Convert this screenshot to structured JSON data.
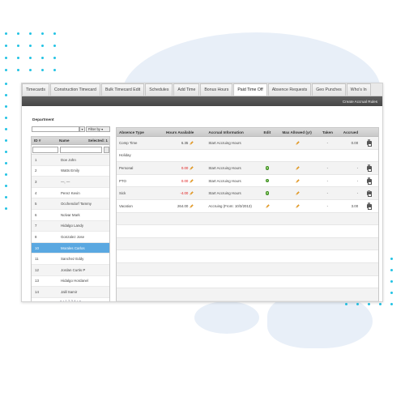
{
  "tabs": [
    {
      "label": "Timecards",
      "active": false
    },
    {
      "label": "Construction Timecard",
      "active": false
    },
    {
      "label": "Bulk Timecard Edit",
      "active": false
    },
    {
      "label": "Schedules",
      "active": false
    },
    {
      "label": "Add Time",
      "active": false
    },
    {
      "label": "Bonus Hours",
      "active": false
    },
    {
      "label": "Paid Time Off",
      "active": true
    },
    {
      "label": "Absence Requests",
      "active": false
    },
    {
      "label": "Geo Punches",
      "active": false
    },
    {
      "label": "Who's In",
      "active": false
    }
  ],
  "toolbar": {
    "create_rules": "Create Accrual Rules"
  },
  "left": {
    "department_label": "Department",
    "department_value": "",
    "filter_button": "Filter by",
    "headers": {
      "id": "ID #",
      "name": "Name",
      "selected": "Selected: 1"
    },
    "employees": [
      {
        "id": "1",
        "name": "Doe John"
      },
      {
        "id": "2",
        "name": "Watts Emily"
      },
      {
        "id": "3",
        "name": "—, —"
      },
      {
        "id": "4",
        "name": "Perez Kevin"
      },
      {
        "id": "5",
        "name": "Occhendorf Tammy"
      },
      {
        "id": "6",
        "name": "Nolvar Mark"
      },
      {
        "id": "7",
        "name": "Hidalgo Landy"
      },
      {
        "id": "8",
        "name": "Gonzalez Jose"
      },
      {
        "id": "10",
        "name": "Morales Carlos",
        "selected": true
      },
      {
        "id": "11",
        "name": "Sanchez Eddy"
      },
      {
        "id": "12",
        "name": "Jordan Curtis P"
      },
      {
        "id": "13",
        "name": "Hidalgo Hordanel"
      },
      {
        "id": "14",
        "name": "Jalil Samir"
      },
      {
        "id": "15",
        "name": "Delabore Miguel"
      }
    ],
    "pager": [
      "«",
      "‹",
      "1",
      "2",
      "3",
      "4",
      "›",
      "»"
    ]
  },
  "grid": {
    "headers": {
      "type": "Absence Type",
      "hours": "Hours Available",
      "accrual": "Accrual Information",
      "edit": "Edit",
      "max": "Max Allowed (yr)",
      "taken": "Taken",
      "accrued": "Accrued"
    },
    "rows": [
      {
        "type": "Comp Time",
        "hours": "6.35",
        "hours_red": false,
        "accrual": "Start Accruing Hours",
        "edit": "none",
        "max_pencil": true,
        "max": "",
        "taken": "-",
        "accrued": "0.00",
        "print": true
      },
      {
        "type": "Holiday",
        "hours": "",
        "hours_red": false,
        "accrual": "",
        "edit": "none",
        "max_pencil": false,
        "max": "",
        "taken": "",
        "accrued": "",
        "print": false
      },
      {
        "type": "Personal",
        "hours": "0.00",
        "hours_red": true,
        "accrual": "Start Accruing Hours",
        "edit": "green",
        "max_pencil": true,
        "max": "",
        "taken": "-",
        "accrued": "-",
        "print": true
      },
      {
        "type": "PTO",
        "hours": "0.00",
        "hours_red": true,
        "accrual": "Start Accruing Hours",
        "edit": "green",
        "max_pencil": true,
        "max": "",
        "taken": "-",
        "accrued": "-",
        "print": true
      },
      {
        "type": "Sick",
        "hours": "-4.00",
        "hours_red": true,
        "accrual": "Start Accruing Hours",
        "edit": "green",
        "max_pencil": true,
        "max": "",
        "taken": "-",
        "accrued": "-",
        "print": true
      },
      {
        "type": "Vacation",
        "hours": "264.00",
        "hours_red": false,
        "accrual": "Accruing (From: 10/3/2013)",
        "edit": "pencil",
        "max_pencil": true,
        "max": "",
        "taken": "-",
        "accrued": "3.00",
        "print": true
      }
    ],
    "empty_rows": 8
  },
  "colors": {
    "accent_dots": "#23c3e4",
    "selected_row": "#5aa8e1",
    "negative_hours": "#e02020",
    "toolbar": "#4f4f4f"
  },
  "icons": {
    "pencil": "pencil-icon",
    "edit_ok": "green-check-icon",
    "print": "printer-icon"
  }
}
